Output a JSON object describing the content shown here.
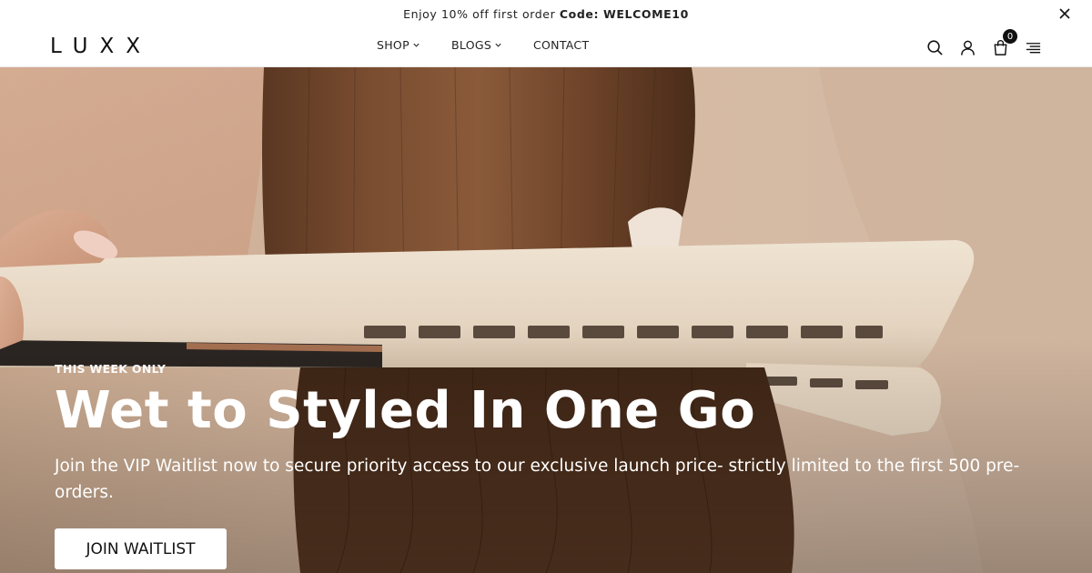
{
  "announcement": {
    "text": "Enjoy 10% off first order ",
    "code_label": "Code: WELCOME10",
    "close_icon": "close-icon"
  },
  "header": {
    "logo": "LUXX",
    "nav": [
      {
        "label": "SHOP",
        "has_dropdown": true
      },
      {
        "label": "BLOGS",
        "has_dropdown": true
      },
      {
        "label": "CONTACT",
        "has_dropdown": false
      }
    ],
    "icons": [
      "search-icon",
      "account-icon",
      "cart-icon",
      "menu-icon"
    ],
    "cart_count": "0"
  },
  "hero": {
    "eyebrow": "THIS WEEK ONLY",
    "headline": "Wet to Styled In One Go",
    "subtext": "Join the VIP Waitlist now to secure priority access to our exclusive launch price- strictly limited to the first 500 pre-orders.",
    "cta_label": "JOIN WAITLIST"
  }
}
